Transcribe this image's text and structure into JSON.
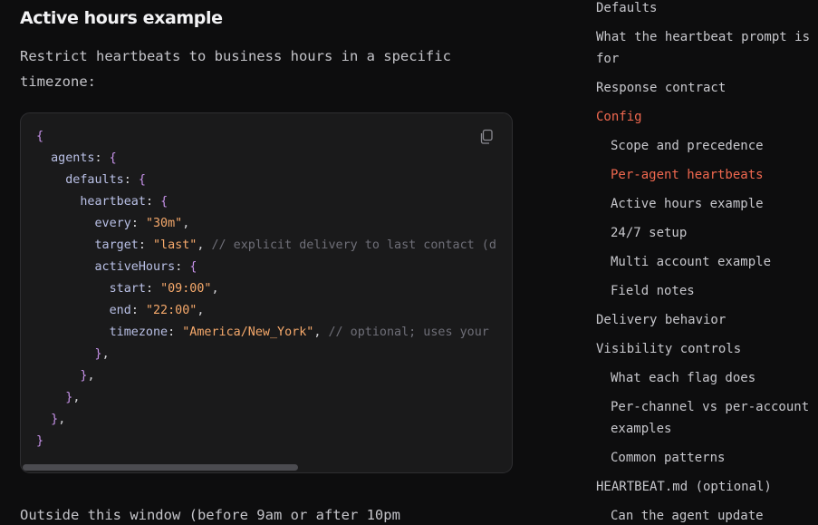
{
  "article": {
    "section_title": "Active hours example",
    "intro": "Restrict heartbeats to business hours in a specific timezone:",
    "outro": "Outside this window (before 9am or after 10pm",
    "code": {
      "copy_icon": "copy-icon",
      "lines": [
        {
          "indent": 0,
          "tokens": [
            {
              "t": "p",
              "v": "{"
            }
          ]
        },
        {
          "indent": 1,
          "tokens": [
            {
              "t": "k",
              "v": "agents"
            },
            {
              "t": "pl",
              "v": ": "
            },
            {
              "t": "p",
              "v": "{"
            }
          ]
        },
        {
          "indent": 2,
          "tokens": [
            {
              "t": "k",
              "v": "defaults"
            },
            {
              "t": "pl",
              "v": ": "
            },
            {
              "t": "p",
              "v": "{"
            }
          ]
        },
        {
          "indent": 3,
          "tokens": [
            {
              "t": "k",
              "v": "heartbeat"
            },
            {
              "t": "pl",
              "v": ": "
            },
            {
              "t": "p",
              "v": "{"
            }
          ]
        },
        {
          "indent": 4,
          "tokens": [
            {
              "t": "k",
              "v": "every"
            },
            {
              "t": "pl",
              "v": ": "
            },
            {
              "t": "s",
              "v": "\"30m\""
            },
            {
              "t": "pl",
              "v": ","
            }
          ]
        },
        {
          "indent": 4,
          "tokens": [
            {
              "t": "k",
              "v": "target"
            },
            {
              "t": "pl",
              "v": ": "
            },
            {
              "t": "s",
              "v": "\"last\""
            },
            {
              "t": "pl",
              "v": ", "
            },
            {
              "t": "c",
              "v": "// explicit delivery to last contact (d"
            }
          ]
        },
        {
          "indent": 4,
          "tokens": [
            {
              "t": "k",
              "v": "activeHours"
            },
            {
              "t": "pl",
              "v": ": "
            },
            {
              "t": "p",
              "v": "{"
            }
          ]
        },
        {
          "indent": 5,
          "tokens": [
            {
              "t": "k",
              "v": "start"
            },
            {
              "t": "pl",
              "v": ": "
            },
            {
              "t": "s",
              "v": "\"09:00\""
            },
            {
              "t": "pl",
              "v": ","
            }
          ]
        },
        {
          "indent": 5,
          "tokens": [
            {
              "t": "k",
              "v": "end"
            },
            {
              "t": "pl",
              "v": ": "
            },
            {
              "t": "s",
              "v": "\"22:00\""
            },
            {
              "t": "pl",
              "v": ","
            }
          ]
        },
        {
          "indent": 5,
          "tokens": [
            {
              "t": "k",
              "v": "timezone"
            },
            {
              "t": "pl",
              "v": ": "
            },
            {
              "t": "s",
              "v": "\"America/New_York\""
            },
            {
              "t": "pl",
              "v": ", "
            },
            {
              "t": "c",
              "v": "// optional; uses your"
            }
          ]
        },
        {
          "indent": 4,
          "tokens": [
            {
              "t": "p",
              "v": "}"
            },
            {
              "t": "pl",
              "v": ","
            }
          ]
        },
        {
          "indent": 3,
          "tokens": [
            {
              "t": "p",
              "v": "}"
            },
            {
              "t": "pl",
              "v": ","
            }
          ]
        },
        {
          "indent": 2,
          "tokens": [
            {
              "t": "p",
              "v": "}"
            },
            {
              "t": "pl",
              "v": ","
            }
          ]
        },
        {
          "indent": 1,
          "tokens": [
            {
              "t": "p",
              "v": "}"
            },
            {
              "t": "pl",
              "v": ","
            }
          ]
        },
        {
          "indent": 0,
          "tokens": [
            {
              "t": "p",
              "v": "}"
            }
          ]
        }
      ]
    }
  },
  "toc": {
    "items": [
      {
        "label": "Defaults",
        "level": 1,
        "active": false
      },
      {
        "label": "What the heartbeat prompt is",
        "label2": "for",
        "level": 1,
        "active": false
      },
      {
        "label": "Response contract",
        "level": 1,
        "active": false
      },
      {
        "label": "Config",
        "level": 1,
        "active": true
      },
      {
        "label": "Scope and precedence",
        "level": 2,
        "active": false
      },
      {
        "label": "Per-agent heartbeats",
        "level": 2,
        "active": true
      },
      {
        "label": "Active hours example",
        "level": 2,
        "active": false
      },
      {
        "label": "24/7 setup",
        "level": 2,
        "active": false
      },
      {
        "label": "Multi account example",
        "level": 2,
        "active": false
      },
      {
        "label": "Field notes",
        "level": 2,
        "active": false
      },
      {
        "label": "Delivery behavior",
        "level": 1,
        "active": false
      },
      {
        "label": "Visibility controls",
        "level": 1,
        "active": false
      },
      {
        "label": "What each flag does",
        "level": 2,
        "active": false
      },
      {
        "label": "Per-channel vs per-account",
        "label2": "examples",
        "level": 2,
        "active": false
      },
      {
        "label": "Common patterns",
        "level": 2,
        "active": false
      },
      {
        "label": "HEARTBEAT.md (optional)",
        "level": 1,
        "active": false
      },
      {
        "label": "Can the agent update",
        "level": 2,
        "active": false
      }
    ]
  },
  "colors": {
    "background": "#0d0d0e",
    "code_background": "#1a1a1b",
    "accent_active": "#f0684f",
    "code_punctuation": "#c792ea",
    "code_key": "#b9c0e6",
    "code_string": "#f6a96b",
    "code_comment": "#6f6f78"
  }
}
